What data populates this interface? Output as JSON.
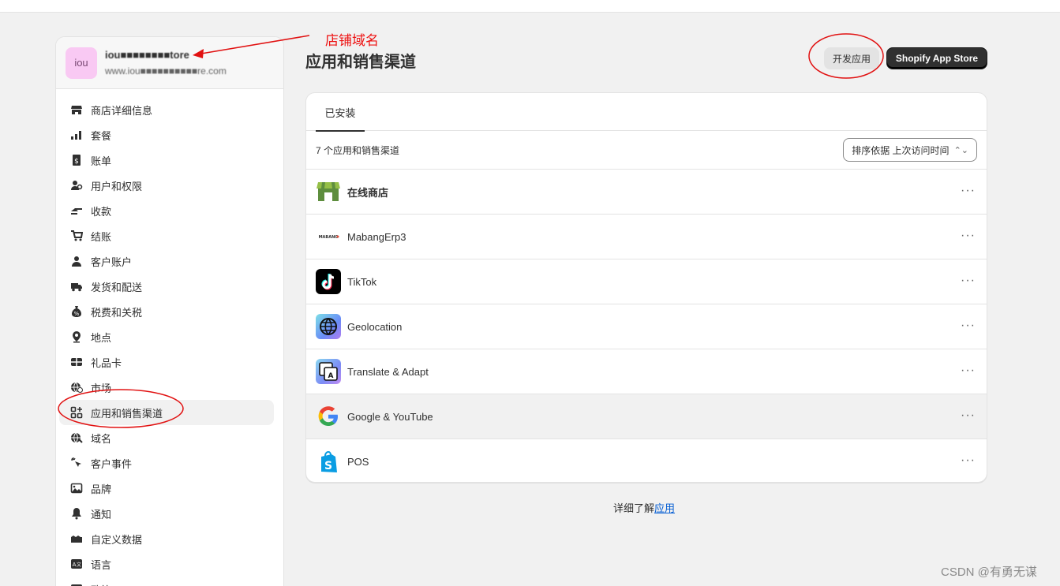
{
  "store": {
    "avatar_text": "iou",
    "name": "iou■■■■■■■■tore",
    "domain": "www.iou■■■■■■■■■■re.com"
  },
  "nav": [
    {
      "label": "商店详细信息",
      "icon": "store-icon"
    },
    {
      "label": "套餐",
      "icon": "plan-icon"
    },
    {
      "label": "账单",
      "icon": "billing-icon"
    },
    {
      "label": "用户和权限",
      "icon": "user-permissions-icon"
    },
    {
      "label": "收款",
      "icon": "payments-icon"
    },
    {
      "label": "结账",
      "icon": "cart-icon"
    },
    {
      "label": "客户账户",
      "icon": "person-icon"
    },
    {
      "label": "发货和配送",
      "icon": "truck-icon"
    },
    {
      "label": "税费和关税",
      "icon": "tax-icon"
    },
    {
      "label": "地点",
      "icon": "location-icon"
    },
    {
      "label": "礼品卡",
      "icon": "gift-card-icon"
    },
    {
      "label": "市场",
      "icon": "globe-dollar-icon"
    },
    {
      "label": "应用和销售渠道",
      "icon": "apps-icon",
      "active": true
    },
    {
      "label": "域名",
      "icon": "globe-icon"
    },
    {
      "label": "客户事件",
      "icon": "cursor-icon"
    },
    {
      "label": "品牌",
      "icon": "brand-icon"
    },
    {
      "label": "通知",
      "icon": "bell-icon"
    },
    {
      "label": "自定义数据",
      "icon": "database-icon"
    },
    {
      "label": "语言",
      "icon": "language-icon"
    },
    {
      "label": "政策",
      "icon": "policy-icon"
    }
  ],
  "page": {
    "title": "应用和销售渠道",
    "dev_button": "开发应用",
    "store_button": "Shopify App Store"
  },
  "card": {
    "tab": "已安装",
    "count_text": "7 个应用和销售渠道",
    "sort_text": "排序依据 上次访问时间",
    "apps": [
      {
        "name": "在线商店",
        "icon": "online-store-icon",
        "bold": true
      },
      {
        "name": "MabangErp3",
        "icon": "mabang-logo-icon",
        "logo_text": "MABANG"
      },
      {
        "name": "TikTok",
        "icon": "tiktok-icon"
      },
      {
        "name": "Geolocation",
        "icon": "geolocation-globe-icon"
      },
      {
        "name": "Translate & Adapt",
        "icon": "translate-icon"
      },
      {
        "name": "Google & YouTube",
        "icon": "google-icon",
        "hover": true
      },
      {
        "name": "POS",
        "icon": "shopify-bag-icon"
      }
    ],
    "more_glyph": "···"
  },
  "footer": {
    "learn_prefix": "详细了解",
    "learn_link": "应用"
  },
  "annotation": {
    "label": "店铺域名",
    "color": "#e11111"
  },
  "watermark": "CSDN @有勇无谋"
}
